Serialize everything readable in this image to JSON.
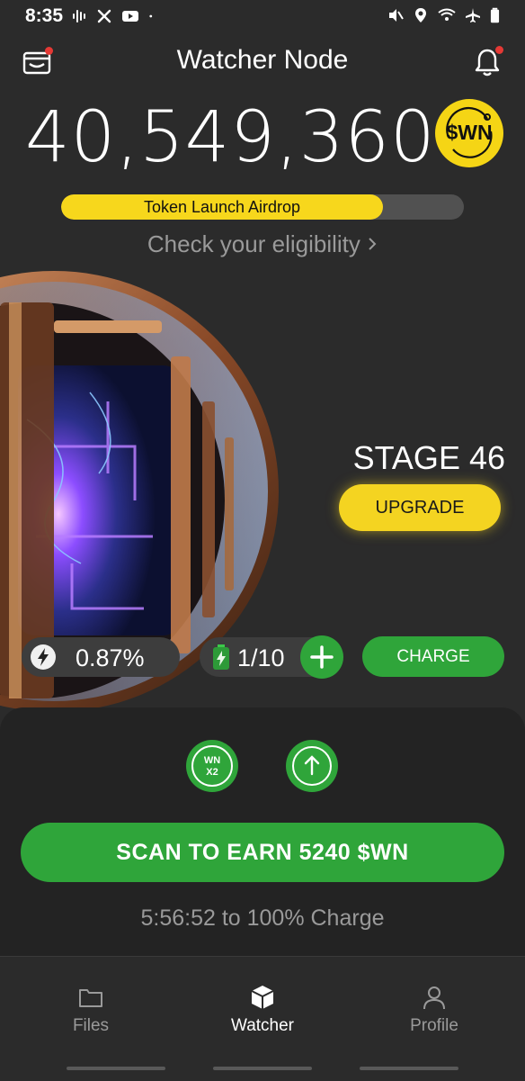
{
  "status_bar": {
    "time": "8:35",
    "left_icons": [
      "audio-icon",
      "x-icon",
      "youtube-icon",
      "dot-icon"
    ],
    "right_icons": [
      "mute-icon",
      "location-icon",
      "wifi-icon",
      "airplane-icon",
      "battery-icon"
    ]
  },
  "header": {
    "title": "Watcher Node",
    "left_icon": "wallet-icon",
    "right_icon": "bell-icon",
    "notification_color": "#e53935"
  },
  "balance": {
    "amount": "40,549,360",
    "token_badge": "$WN"
  },
  "airdrop": {
    "label": "Token Launch Airdrop",
    "progress": 0.8,
    "link_text": "Check your eligibility"
  },
  "stage": {
    "title": "STAGE 46",
    "upgrade_label": "UPGRADE"
  },
  "stats": {
    "rate": "0.87%",
    "energy": "1/10",
    "charge_label": "CHARGE"
  },
  "boosts": [
    {
      "icon": "wn-x2-icon",
      "line1": "WN",
      "line2": "X2"
    },
    {
      "icon": "arrow-up-icon"
    }
  ],
  "scan": {
    "label": "SCAN TO EARN 5240 $WN",
    "charge_info": "5:56:52 to 100% Charge"
  },
  "nav": {
    "items": [
      {
        "label": "Files",
        "icon": "folder-icon",
        "active": false
      },
      {
        "label": "Watcher",
        "icon": "cube-icon",
        "active": true
      },
      {
        "label": "Profile",
        "icon": "user-icon",
        "active": false
      }
    ]
  },
  "colors": {
    "background": "#2b2b2b",
    "accent_yellow": "#f7d71c",
    "accent_green": "#2fa53a",
    "muted_text": "#9a9a9a"
  }
}
